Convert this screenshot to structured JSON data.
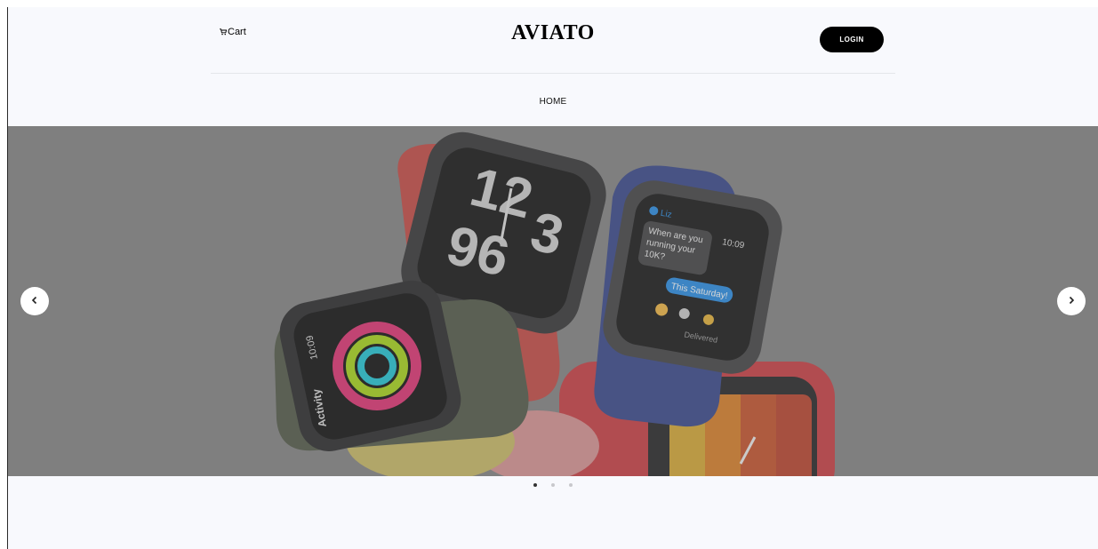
{
  "header": {
    "cart_label": "Cart",
    "logo": "AVIATO",
    "login_label": "LOGIN"
  },
  "nav": {
    "items": [
      "HOME"
    ]
  },
  "hero": {
    "watch_text": {
      "hour": "12",
      "hour_bottom": "96",
      "hour_bottom2": "3",
      "msg_contact": "Liz",
      "msg_time": "10:09",
      "msg_text_1": "When are you",
      "msg_text_2": "running your",
      "msg_text_3": "10K?",
      "msg_reply": "This Saturday!",
      "msg_status": "Delivered",
      "activity_time": "10:09",
      "activity_label": "Activity"
    },
    "active_slide": 0,
    "slide_count": 3
  },
  "icons": {
    "cart": "cart-icon",
    "prev": "chevron-left-icon",
    "next": "chevron-right-icon"
  },
  "colors": {
    "page_bg": "#f8f9fd",
    "overlay": "#7f7f7f",
    "button_bg": "#000000"
  }
}
